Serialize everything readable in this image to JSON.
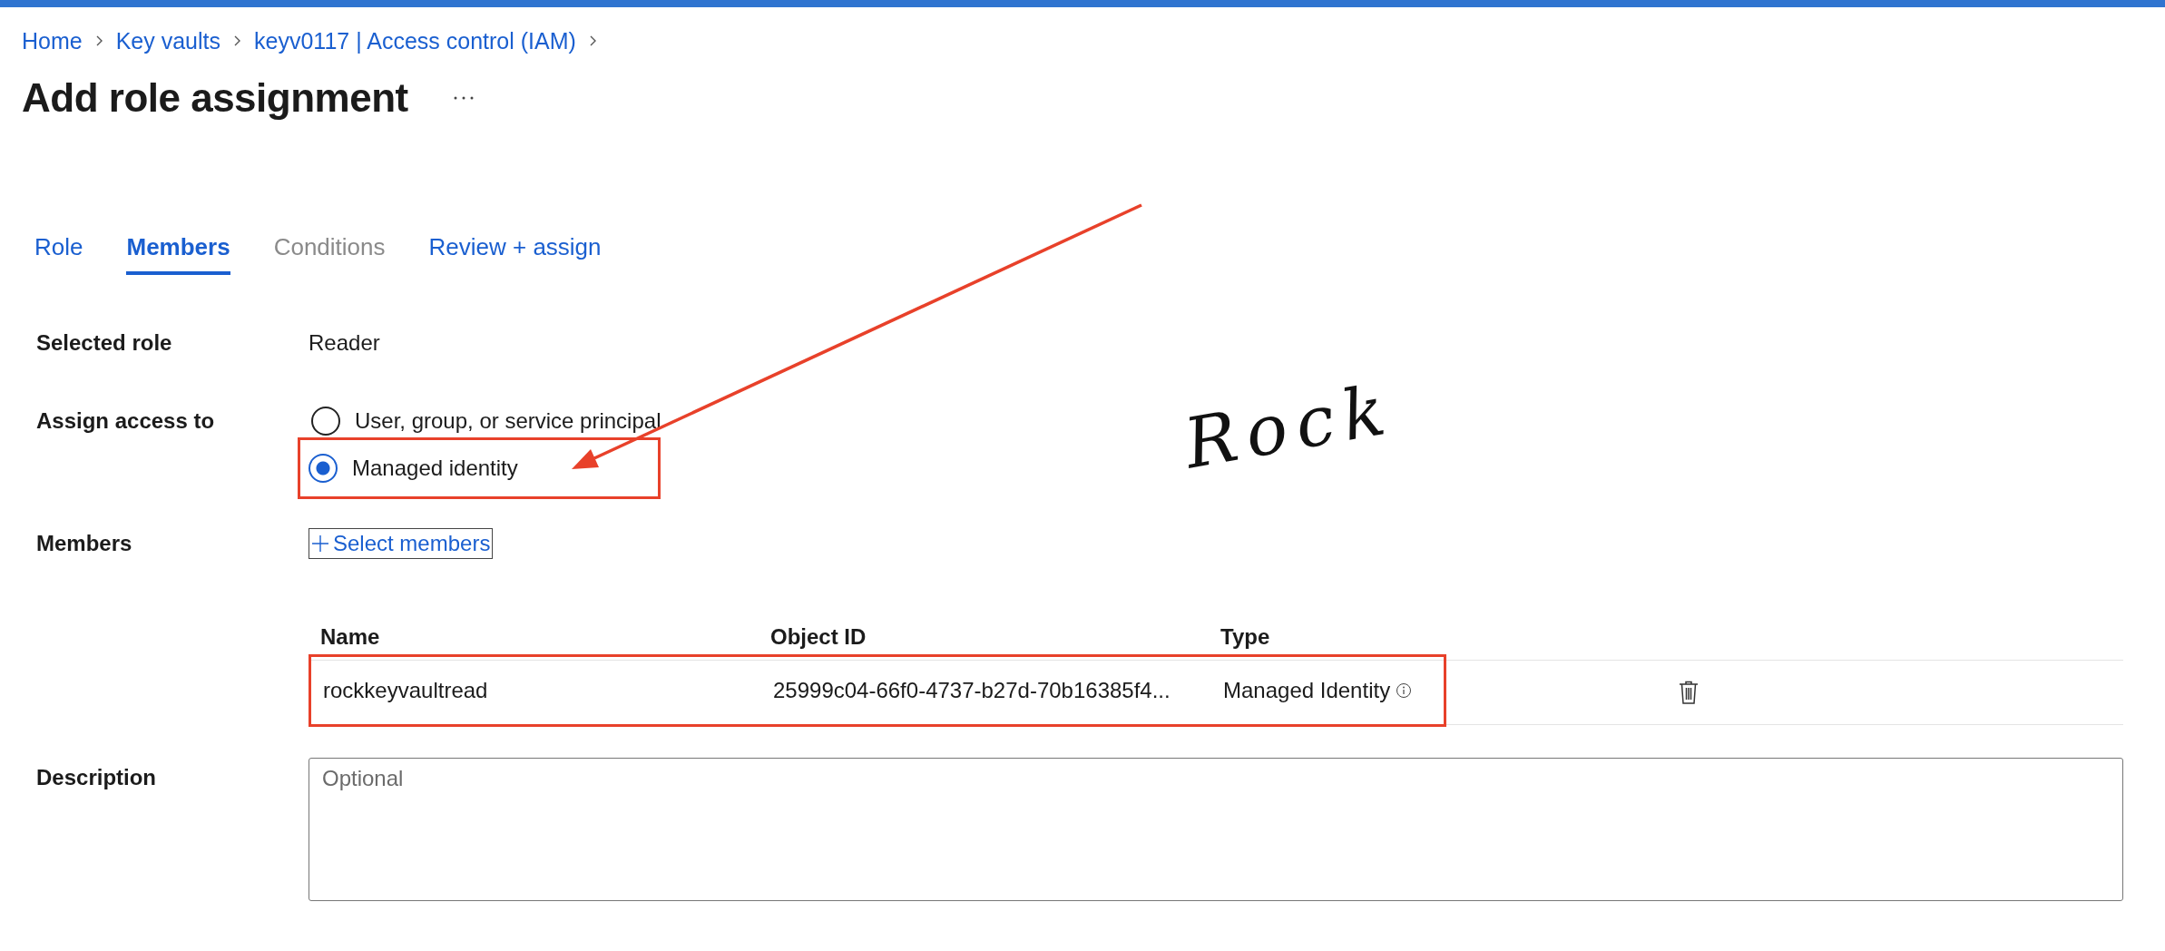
{
  "breadcrumb": [
    {
      "label": "Home"
    },
    {
      "label": "Key vaults"
    },
    {
      "label": "keyv0117 | Access control (IAM)"
    }
  ],
  "title": "Add role assignment",
  "tabs": [
    {
      "label": "Role",
      "selected": false,
      "disabled": false
    },
    {
      "label": "Members",
      "selected": true,
      "disabled": false
    },
    {
      "label": "Conditions",
      "selected": false,
      "disabled": true
    },
    {
      "label": "Review + assign",
      "selected": false,
      "disabled": false
    }
  ],
  "form": {
    "selected_role": {
      "label": "Selected role",
      "value": "Reader"
    },
    "assign_access": {
      "label": "Assign access to",
      "options": [
        {
          "label": "User, group, or service principal",
          "selected": false,
          "highlighted": false
        },
        {
          "label": "Managed identity",
          "selected": true,
          "highlighted": true
        }
      ]
    },
    "members": {
      "label": "Members",
      "button": "Select members",
      "table": {
        "columns": [
          "Name",
          "Object ID",
          "Type"
        ],
        "rows": [
          {
            "name": "rockkeyvaultread",
            "object_id": "25999c04-66f0-4737-b27d-70b16385f4...",
            "type": "Managed Identity",
            "highlighted": true
          }
        ]
      }
    },
    "description": {
      "label": "Description",
      "placeholder": "Optional"
    }
  },
  "annotations": [
    {
      "kind": "arrow"
    },
    {
      "kind": "handwriting",
      "text": "Rock"
    }
  ]
}
